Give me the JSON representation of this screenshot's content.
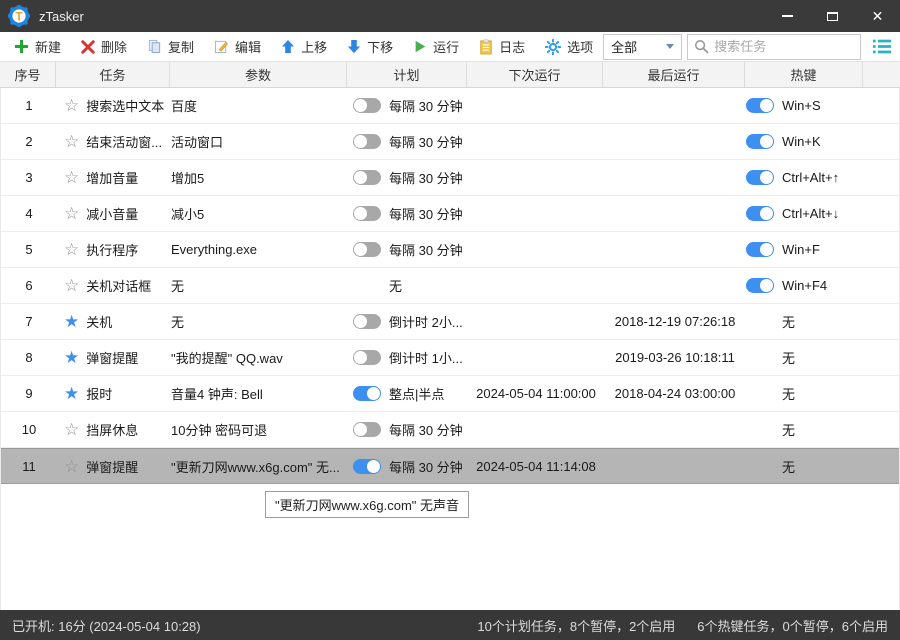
{
  "window": {
    "title": "zTasker"
  },
  "toolbar": {
    "buttons": [
      {
        "id": "new",
        "label": "新建"
      },
      {
        "id": "delete",
        "label": "删除"
      },
      {
        "id": "copy",
        "label": "复制"
      },
      {
        "id": "edit",
        "label": "编辑"
      },
      {
        "id": "move-up",
        "label": "上移"
      },
      {
        "id": "move-down",
        "label": "下移"
      },
      {
        "id": "run",
        "label": "运行"
      },
      {
        "id": "log",
        "label": "日志"
      },
      {
        "id": "options",
        "label": "选项"
      }
    ],
    "filter_value": "全部",
    "search_placeholder": "搜索任务"
  },
  "table": {
    "columns": [
      "序号",
      "任务",
      "参数",
      "计划",
      "下次运行",
      "最后运行",
      "热键"
    ],
    "rows": [
      {
        "num": "1",
        "starred": false,
        "task": "搜索选中文本",
        "params": "百度",
        "schedule": {
          "toggle": false,
          "text": "每隔 30 分钟"
        },
        "next_run": "",
        "last_run": "",
        "hotkey": {
          "toggle": true,
          "text": "Win+S"
        },
        "selected": false
      },
      {
        "num": "2",
        "starred": false,
        "task": "结束活动窗...",
        "params": "活动窗口",
        "schedule": {
          "toggle": false,
          "text": "每隔 30 分钟"
        },
        "next_run": "",
        "last_run": "",
        "hotkey": {
          "toggle": true,
          "text": "Win+K"
        },
        "selected": false
      },
      {
        "num": "3",
        "starred": false,
        "task": "增加音量",
        "params": "增加5",
        "schedule": {
          "toggle": false,
          "text": "每隔 30 分钟"
        },
        "next_run": "",
        "last_run": "",
        "hotkey": {
          "toggle": true,
          "text": "Ctrl+Alt+↑"
        },
        "selected": false
      },
      {
        "num": "4",
        "starred": false,
        "task": "减小音量",
        "params": "减小5",
        "schedule": {
          "toggle": false,
          "text": "每隔 30 分钟"
        },
        "next_run": "",
        "last_run": "",
        "hotkey": {
          "toggle": true,
          "text": "Ctrl+Alt+↓"
        },
        "selected": false
      },
      {
        "num": "5",
        "starred": false,
        "task": "执行程序",
        "params": "Everything.exe",
        "schedule": {
          "toggle": false,
          "text": "每隔 30 分钟"
        },
        "next_run": "",
        "last_run": "",
        "hotkey": {
          "toggle": true,
          "text": "Win+F"
        },
        "selected": false
      },
      {
        "num": "6",
        "starred": false,
        "task": "关机对话框",
        "params": "无",
        "schedule": {
          "toggle": null,
          "text": "无"
        },
        "next_run": "",
        "last_run": "",
        "hotkey": {
          "toggle": true,
          "text": "Win+F4"
        },
        "selected": false
      },
      {
        "num": "7",
        "starred": true,
        "task": "关机",
        "params": "无",
        "schedule": {
          "toggle": false,
          "text": "倒计时 2小..."
        },
        "next_run": "",
        "last_run": "2018-12-19 07:26:18",
        "hotkey": {
          "toggle": null,
          "text": "无"
        },
        "selected": false
      },
      {
        "num": "8",
        "starred": true,
        "task": "弹窗提醒",
        "params": "\"我的提醒\" QQ.wav",
        "schedule": {
          "toggle": false,
          "text": "倒计时 1小..."
        },
        "next_run": "",
        "last_run": "2019-03-26 10:18:11",
        "hotkey": {
          "toggle": null,
          "text": "无"
        },
        "selected": false
      },
      {
        "num": "9",
        "starred": true,
        "task": "报时",
        "params": "音量4 钟声: Bell",
        "schedule": {
          "toggle": true,
          "text": "整点|半点"
        },
        "next_run": "2024-05-04 11:00:00",
        "last_run": "2018-04-24 03:00:00",
        "hotkey": {
          "toggle": null,
          "text": "无"
        },
        "selected": false
      },
      {
        "num": "10",
        "starred": false,
        "task": "挡屏休息",
        "params": "10分钟 密码可退",
        "schedule": {
          "toggle": false,
          "text": "每隔 30 分钟"
        },
        "next_run": "",
        "last_run": "",
        "hotkey": {
          "toggle": null,
          "text": "无"
        },
        "selected": false
      },
      {
        "num": "11",
        "starred": false,
        "task": "弹窗提醒",
        "params": "\"更新刀网www.x6g.com\" 无...",
        "schedule": {
          "toggle": true,
          "text": "每隔 30 分钟"
        },
        "next_run": "2024-05-04 11:14:08",
        "last_run": "",
        "hotkey": {
          "toggle": null,
          "text": "无"
        },
        "selected": true
      }
    ]
  },
  "tooltip": {
    "text": "\"更新刀网www.x6g.com\" 无声音"
  },
  "statusbar": {
    "left": "已开机: 16分 (2024-05-04 10:28)",
    "plan_stats": "10个计划任务，8个暂停，2个启用",
    "hotkey_stats": "6个热键任务，0个暂停，6个启用"
  },
  "colors": {
    "accent_blue": "#3d8ff0",
    "toggle_off": "#a8a8a8",
    "selected_row": "#b5b5b5",
    "titlebar": "#3a3a3a",
    "statusbar": "#383838",
    "green_icon": "#1ea832",
    "red_icon": "#d93232",
    "teal_icon": "#29b2c6",
    "gear_icon_blue": "#2b9ff2"
  }
}
